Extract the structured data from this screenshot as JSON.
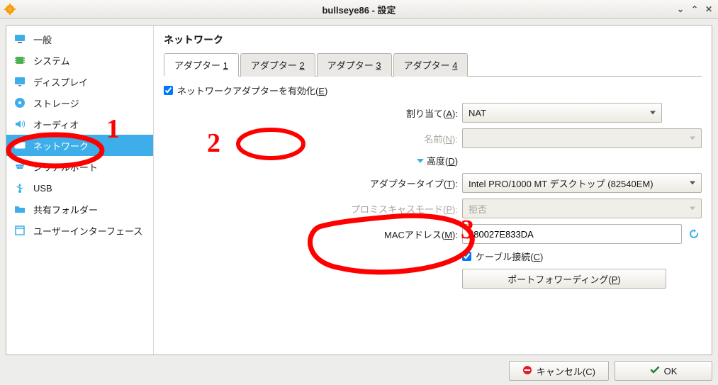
{
  "window": {
    "title": "bullseye86 - 設定"
  },
  "sidebar": {
    "items": [
      {
        "id": "general",
        "label": "一般",
        "icon": "monitor"
      },
      {
        "id": "system",
        "label": "システム",
        "icon": "chip"
      },
      {
        "id": "display",
        "label": "ディスプレイ",
        "icon": "display"
      },
      {
        "id": "storage",
        "label": "ストレージ",
        "icon": "disc"
      },
      {
        "id": "audio",
        "label": "オーディオ",
        "icon": "speaker"
      },
      {
        "id": "network",
        "label": "ネットワーク",
        "icon": "nic",
        "active": true
      },
      {
        "id": "serial",
        "label": "シリアルポート",
        "icon": "serial"
      },
      {
        "id": "usb",
        "label": "USB",
        "icon": "usb"
      },
      {
        "id": "shared",
        "label": "共有フォルダー",
        "icon": "folder"
      },
      {
        "id": "ui",
        "label": "ユーザーインターフェース",
        "icon": "window"
      }
    ]
  },
  "page_header": "ネットワーク",
  "tabs": [
    {
      "label": "アダプター",
      "accel": "1",
      "active": true
    },
    {
      "label": "アダプター",
      "accel": "2"
    },
    {
      "label": "アダプター",
      "accel": "3"
    },
    {
      "label": "アダプター",
      "accel": "4"
    }
  ],
  "form": {
    "enable_adapter": {
      "label": "ネットワークアダプターを有効化(",
      "accel": "E",
      "suffix": ")",
      "checked": true
    },
    "attached": {
      "label": "割り当て(",
      "accel": "A",
      "suffix": "):",
      "value": "NAT"
    },
    "name": {
      "label": "名前(",
      "accel": "N",
      "suffix": "):",
      "value": "",
      "disabled": true
    },
    "advanced": {
      "label": "高度(",
      "accel": "D",
      "suffix": ")"
    },
    "adapter_type": {
      "label": "アダプタータイプ(",
      "accel": "T",
      "suffix": "):",
      "value": "Intel PRO/1000 MT デスクトップ (82540EM)"
    },
    "promiscuous": {
      "label": "プロミスキャスモード(",
      "accel": "P",
      "suffix": "):",
      "value": "拒否",
      "disabled": true
    },
    "mac": {
      "label": "MACアドレス(",
      "accel": "M",
      "suffix": "):",
      "value": "080027E833DA"
    },
    "cable": {
      "label": "ケーブル接続(",
      "accel": "C",
      "suffix": ")",
      "checked": true
    },
    "port_forwarding": {
      "label": "ポートフォワーディング(",
      "accel": "P",
      "suffix": ")"
    }
  },
  "footer": {
    "cancel": {
      "label": "キャンセル(",
      "accel": "C",
      "suffix": ")"
    },
    "ok": {
      "label": "",
      "accel": "O",
      "suffix": "K"
    }
  },
  "annotations": {
    "one": "1",
    "two": "2",
    "three": "3"
  }
}
